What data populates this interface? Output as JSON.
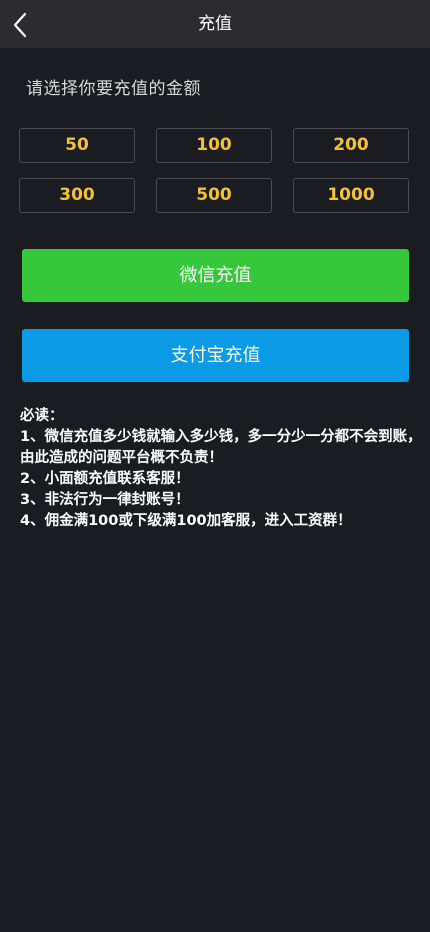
{
  "header": {
    "title": "充值",
    "back_icon": "chevron-left-icon"
  },
  "prompt": "请选择你要充值的金额",
  "amounts": [
    "50",
    "100",
    "200",
    "300",
    "500",
    "1000"
  ],
  "buttons": {
    "wechat_label": "微信充值",
    "alipay_label": "支付宝充值"
  },
  "notice": {
    "heading": "必读：",
    "lines": [
      "1、微信充值多少钱就输入多少钱，多一分少一分都不会到账，由此造成的问题平台概不负责！",
      "2、小面额充值联系客服！",
      "3、非法行为一律封账号！",
      "4、佣金满100或下级满100加客服，进入工资群！"
    ]
  },
  "colors": {
    "background": "#1b1c21",
    "header": "#2c2c30",
    "amount_text": "#f2c230",
    "wechat": "#35c83b",
    "alipay": "#0a9ae6"
  }
}
